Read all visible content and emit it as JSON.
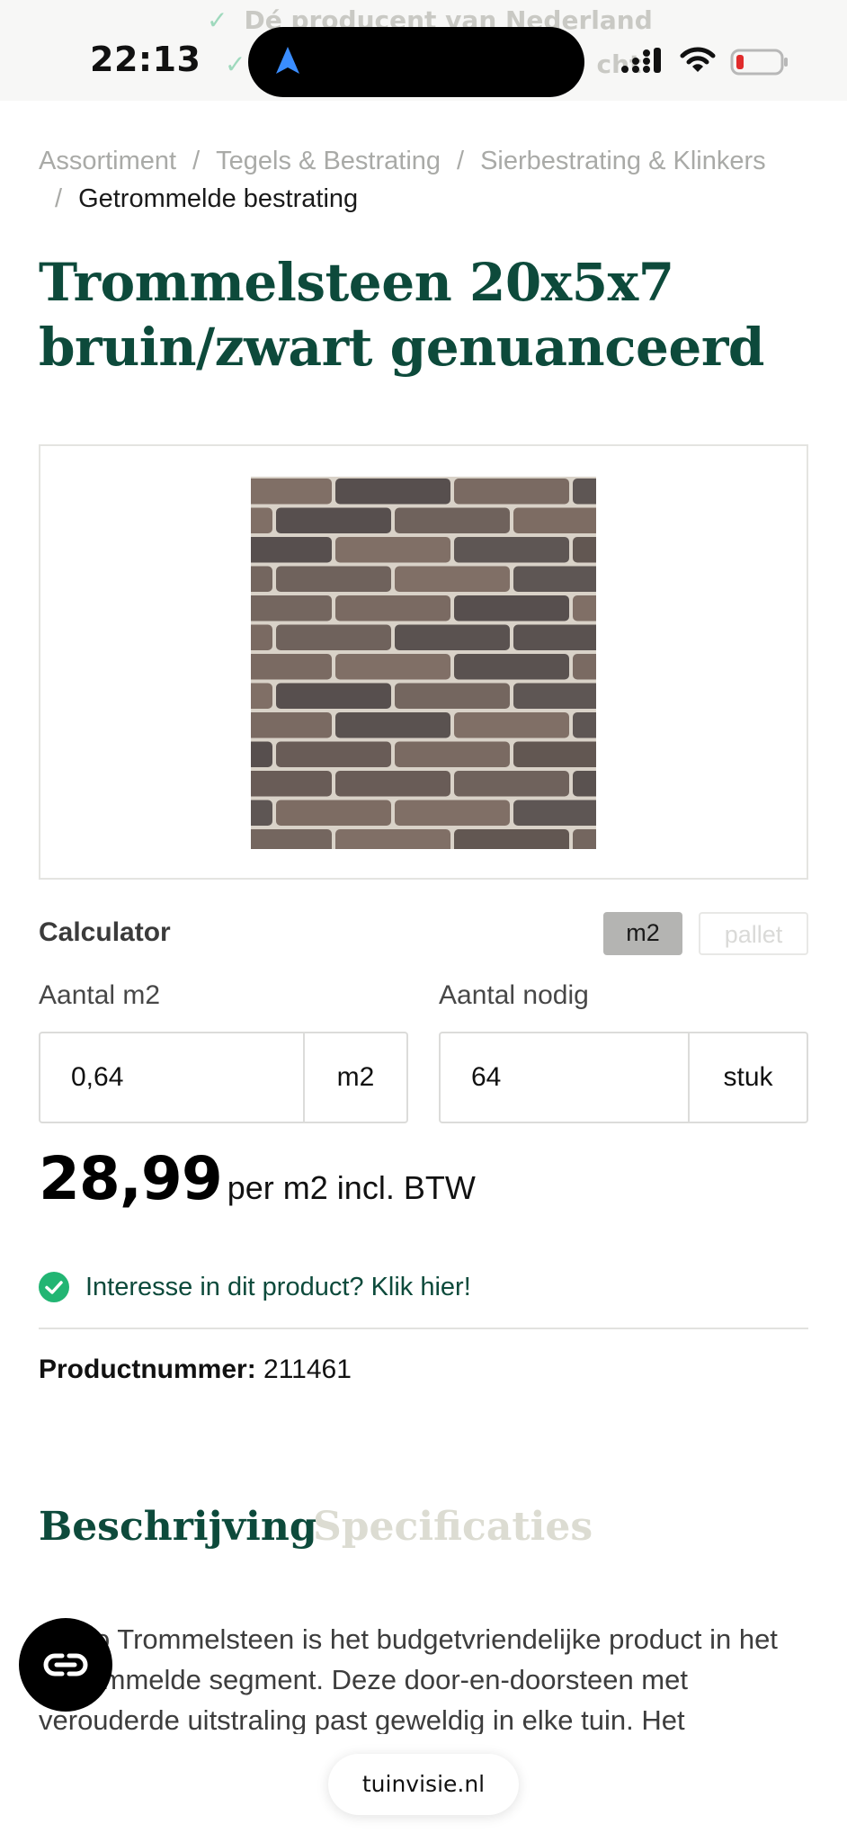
{
  "status_bar": {
    "time": "22:13",
    "banner_line_1": "Dé producent van Nederland",
    "banner_line_2": "cht"
  },
  "breadcrumb": {
    "items": [
      "Assortiment",
      "Tegels & Bestrating",
      "Sierbestrating & Klinkers"
    ],
    "current": "Getrommelde bestrating",
    "separator": "/"
  },
  "product": {
    "title_line_1": "Trommelsteen 20x5x7",
    "title_line_2": "bruin/zwart genuanceerd",
    "product_number_label": "Productnummer:",
    "product_number": "211461"
  },
  "calculator": {
    "label": "Calculator",
    "unit_options": [
      "m2",
      "pallet"
    ],
    "selected_unit": "m2",
    "quantity_label": "Aantal m2",
    "quantity_value": "0,64",
    "quantity_unit": "m2",
    "needed_label": "Aantal nodig",
    "needed_value": "64",
    "needed_unit": "stuk"
  },
  "price": {
    "amount": "28,99",
    "suffix": "per m2 incl. BTW"
  },
  "interest": {
    "text": "Interesse in dit product? Klik hier!"
  },
  "tabs": {
    "active": "Beschrijving",
    "inactive": "Specificaties"
  },
  "description": {
    "text": "Metro Trommelsteen is het budgetvriendelijke product in het getrommelde segment. Deze door-en-doorsteen met verouderde uitstraling past geweldig in elke tuin. Het"
  },
  "browser": {
    "url": "tuinvisie.nl"
  },
  "icons": {
    "navigation": "location-arrow-icon",
    "signal": "cellular-signal-icon",
    "wifi": "wifi-icon",
    "battery": "battery-low-icon",
    "check": "check-circle-icon",
    "chat": "chat-icon"
  },
  "colors": {
    "brand_green": "#0d4a3b",
    "check_green": "#22b573",
    "battery_red": "#e02b2b"
  }
}
